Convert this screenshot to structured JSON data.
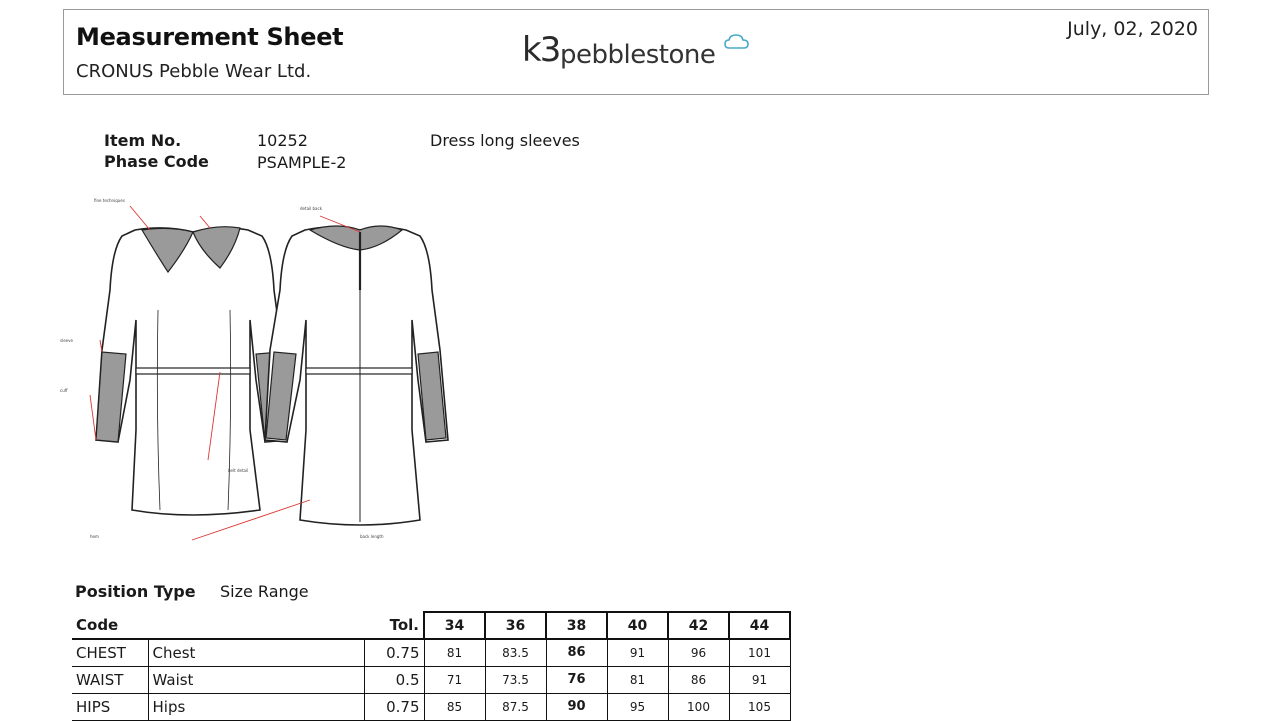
{
  "header": {
    "title": "Measurement Sheet",
    "company": "CRONUS Pebble Wear Ltd.",
    "logo_text": "k3pebblestone",
    "date": "July, 02, 2020"
  },
  "item": {
    "item_no_label": "Item No.",
    "item_no": "10252",
    "description": "Dress long sleeves",
    "phase_label": "Phase Code",
    "phase_code": "PSAMPLE-2"
  },
  "drawing_icon": "dress-technical-sketch",
  "position": {
    "label": "Position Type",
    "value": "Size Range"
  },
  "table": {
    "code_header": "Code",
    "tol_header": "Tol.",
    "sizes": [
      "34",
      "36",
      "38",
      "40",
      "42",
      "44"
    ],
    "base_size_index": 2,
    "rows": [
      {
        "code": "CHEST",
        "name": "Chest",
        "tol": "0.75",
        "values": [
          "81",
          "83.5",
          "86",
          "91",
          "96",
          "101"
        ]
      },
      {
        "code": "WAIST",
        "name": "Waist",
        "tol": "0.5",
        "values": [
          "71",
          "73.5",
          "76",
          "81",
          "86",
          "91"
        ]
      },
      {
        "code": "HIPS",
        "name": "Hips",
        "tol": "0.75",
        "values": [
          "85",
          "87.5",
          "90",
          "95",
          "100",
          "105"
        ]
      }
    ]
  }
}
